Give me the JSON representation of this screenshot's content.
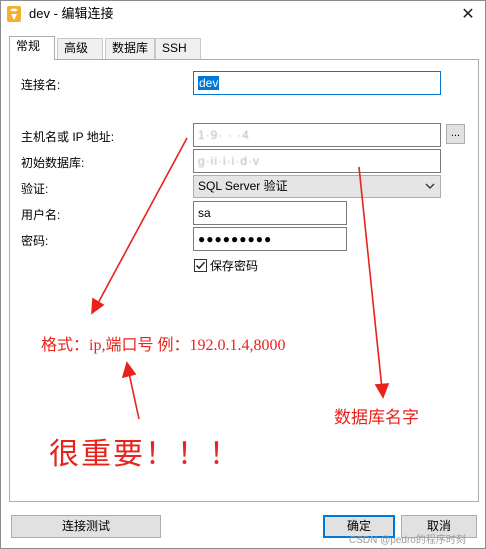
{
  "window": {
    "title": "dev - 编辑连接",
    "close_symbol": "✕"
  },
  "tabs": [
    {
      "label": "常规",
      "active": true
    },
    {
      "label": "高级",
      "active": false
    },
    {
      "label": "数据库",
      "active": false
    },
    {
      "label": "SSH",
      "active": false
    }
  ],
  "form": {
    "connection_name_label": "连接名:",
    "connection_name_value": "dev",
    "host_label": "主机名或 IP 地址:",
    "host_value": "1·9· · ·4",
    "browse_label": "...",
    "initial_db_label": "初始数据库:",
    "initial_db_value": "g·ii·i·i·d·v",
    "auth_label": "验证:",
    "auth_value": "SQL Server 验证",
    "username_label": "用户名:",
    "username_value": "sa",
    "password_label": "密码:",
    "password_value": "●●●●●●●●●",
    "save_password_label": "保存密码",
    "save_password_checked": true
  },
  "annotations": {
    "format_note": "格式：ip,端口号  例：192.0.1.4,8000",
    "db_note": "数据库名字",
    "important_note": "很重要！！！"
  },
  "buttons": {
    "test_connection": "连接测试",
    "ok": "确定",
    "cancel": "取消"
  },
  "watermark": "CSDN @pedro的程序时刻",
  "colors": {
    "accent": "#0078d7",
    "annotation": "#e8231b"
  }
}
